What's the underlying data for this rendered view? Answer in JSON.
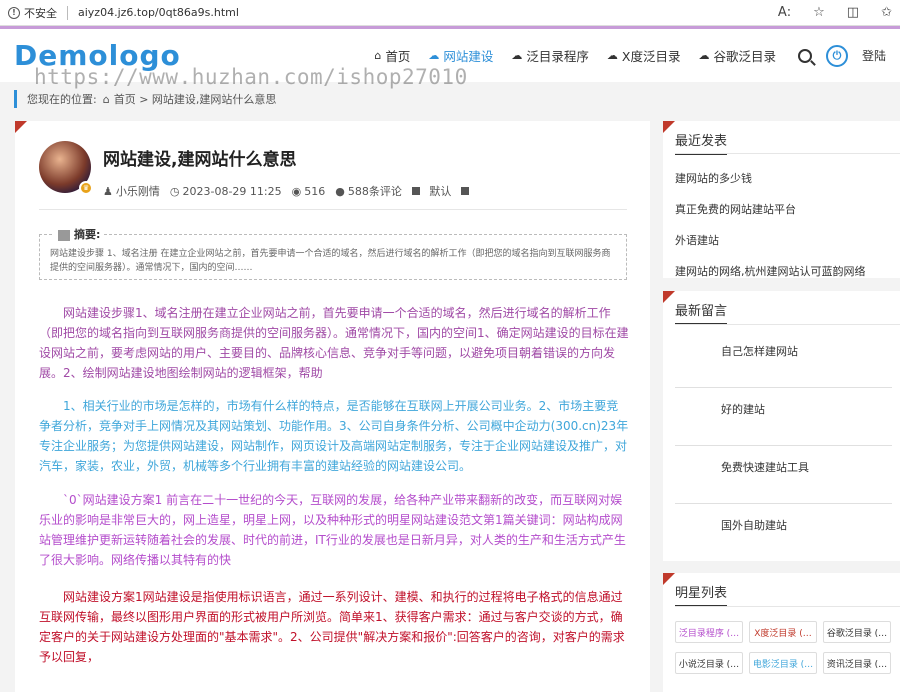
{
  "browser": {
    "security": "不安全",
    "url": "aiyz04.jz6.top/0qt86a9s.html"
  },
  "site": {
    "logo": "Demologo",
    "watermark": "https://www.huzhan.com/ishop27010",
    "nav": [
      {
        "label": "首页"
      },
      {
        "label": "网站建设"
      },
      {
        "label": "泛目录程序"
      },
      {
        "label": "X度泛目录"
      },
      {
        "label": "谷歌泛目录"
      }
    ],
    "login": "登陆"
  },
  "breadcrumb": {
    "prefix": "您现在的位置:",
    "home": "首页",
    "current": "网站建设,建网站什么意思"
  },
  "article": {
    "title": "网站建设,建网站什么意思",
    "author": "小乐刚情",
    "date": "2023-08-29 11:25",
    "views": "516",
    "comments": "588条评论",
    "font": "默认",
    "summary_label": "摘要:",
    "summary": "网站建设步骤 1、域名注册 在建立企业网站之前，首先要申请一个合适的域名，然后进行域名的解析工作（即把您的域名指向到互联网服务商提供的空间服务器）。通常情况下，国内的空间……",
    "paragraphs": [
      "网站建设步骤1、域名注册在建立企业网站之前，首先要申请一个合适的域名，然后进行域名的解析工作（即把您的域名指向到互联网服务商提供的空间服务器）。通常情况下，国内的空间1、确定网站建设的目标在建设网站之前，要考虑网站的用户、主要目的、品牌核心信息、竞争对手等问题，以避免项目朝着错误的方向发展。2、绘制网站建设地图绘制网站的逻辑框架，帮助",
      "1、相关行业的市场是怎样的，市场有什么样的特点，是否能够在互联网上开展公司业务。2、市场主要竞争者分析，竞争对手上网情况及其网站策划、功能作用。3、公司自身条件分析、公司概中企动力(300.cn)23年专注企业服务；为您提供网站建设，网站制作，网页设计及高端网站定制服务，专注于企业网站建设及推广，对汽车，家装，农业，外贸，机械等多个行业拥有丰富的建站经验的网站建设公司。",
      "`0`网站建设方案1 前言在二十一世纪的今天，互联网的发展，给各种产业带来翻新的改变，而互联网对娱乐业的影响是非常巨大的，网上造星，明星上网，以及种种形式的明星网站建设范文第1篇关键词：网站构成网站管理维护更新运转随着社会的发展、时代的前进，IT行业的发展也是日新月异，对人类的生产和生活方式产生了很大影响。网络传播以其特有的快",
      "网站建设方案1网站建设是指使用标识语言，通过一系列设计、建模、和执行的过程将电子格式的信息通过互联网传输，最终以图形用户界面的形式被用户所浏览。简单来1、获得客户需求：通过与客户交谈的方式，确定客户的关于网站建设方处理面的\"基本需求\"。2、公司提供\"解决方案和报价\":回答客户的咨询，对客户的需求予以回复，"
    ]
  },
  "sidebar": {
    "recent_title": "最近发表",
    "recent": [
      "建网站的多少钱",
      "真正免费的网站建站平台",
      "外语建站",
      "建网站的网络,杭州建网站认可蓝韵网络"
    ],
    "comments_title": "最新留言",
    "comments": [
      "自己怎样建网站",
      "好的建站",
      "免费快速建站工具",
      "国外自助建站"
    ],
    "stars_title": "明星列表",
    "tags": [
      {
        "label": "泛目录程序 (…",
        "color": "#b44dcc"
      },
      {
        "label": "X度泛目录 (…",
        "color": "#c0392b"
      },
      {
        "label": "谷歌泛目录 (…",
        "color": "#333333"
      },
      {
        "label": "小说泛目录 (…",
        "color": "#333333"
      },
      {
        "label": "电影泛目录 (…",
        "color": "#3fa6da"
      },
      {
        "label": "资讯泛目录 (…",
        "color": "#333333"
      }
    ]
  }
}
